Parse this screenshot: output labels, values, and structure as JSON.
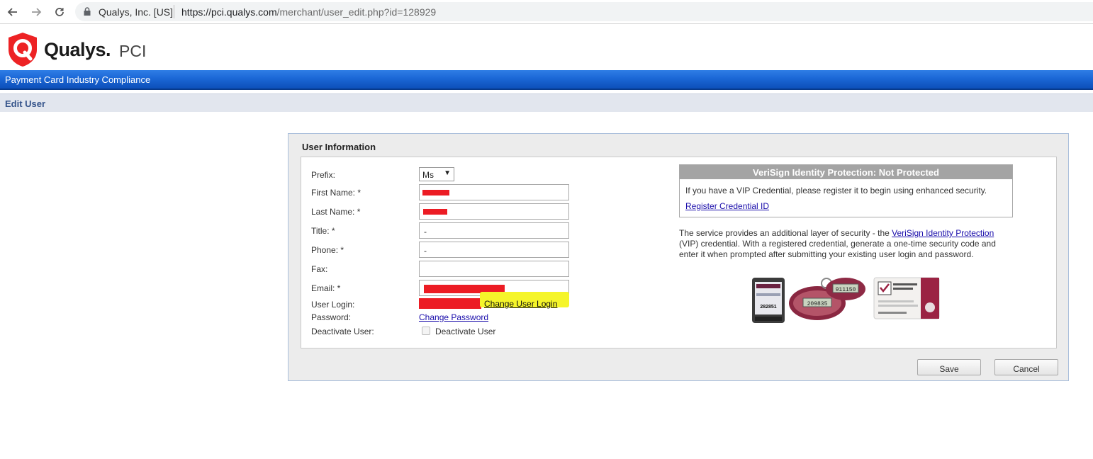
{
  "browser": {
    "site_identity": "Qualys, Inc. [US]",
    "url_host": "https://pci.qualys.com",
    "url_path": "/merchant/user_edit.php?id=128929"
  },
  "logo": {
    "brand": "Qualys.",
    "product": "PCI"
  },
  "product_bar": {
    "title": "Payment Card Industry Compliance"
  },
  "page": {
    "title": "Edit User"
  },
  "panel": {
    "title": "User Information",
    "fields": {
      "prefix": {
        "label": "Prefix:",
        "value": "Ms"
      },
      "first_name": {
        "label": "First Name: *",
        "value": ""
      },
      "last_name": {
        "label": "Last Name: *",
        "value": ""
      },
      "title": {
        "label": "Title: *",
        "value": "-"
      },
      "phone": {
        "label": "Phone: *",
        "value": "-"
      },
      "fax": {
        "label": "Fax:",
        "value": ""
      },
      "email": {
        "label": "Email: *",
        "value": ""
      },
      "user_login": {
        "label": "User Login:",
        "link": "Change User Login"
      },
      "password": {
        "label": "Password:",
        "link": "Change Password"
      },
      "deactivate": {
        "label": "Deactivate User:",
        "checkbox_label": "Deactivate User",
        "checked": false
      }
    },
    "vip": {
      "header": "VeriSign Identity Protection: Not Protected",
      "text": "If you have a VIP Credential, please register it to begin using enhanced security.",
      "register_link": "Register Credential ID",
      "desc_before": "The service provides an additional layer of security - the ",
      "desc_link": "VeriSign Identity Protection",
      "desc_after": " (VIP) credential. With a registered credential, generate a one-time security code and enter it when prompted after submitting your existing user login and password.",
      "device_codes": [
        "282851",
        "911150",
        "209835"
      ]
    },
    "buttons": {
      "save": "Save",
      "cancel": "Cancel"
    }
  },
  "colors": {
    "product_bar": "#1b67d6",
    "edit_bar": "#e2e6ee",
    "redaction": "#ec1c24",
    "highlight": "#f5f52a",
    "vip_header": "#a4a4a4",
    "link": "#1a0dab"
  },
  "icons": [
    "back-arrow-icon",
    "forward-arrow-icon",
    "reload-icon",
    "lock-icon",
    "qualys-shield-icon",
    "dropdown-arrow-icon"
  ]
}
